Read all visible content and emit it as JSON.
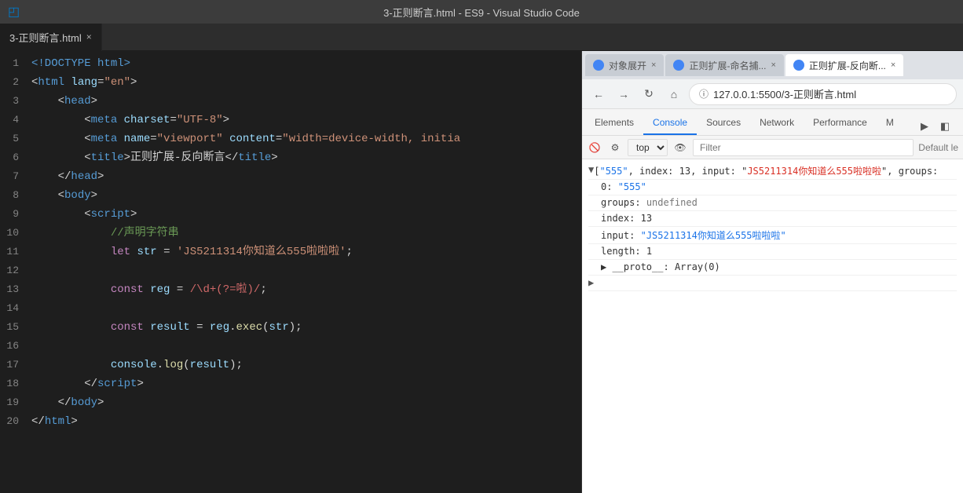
{
  "titleBar": {
    "title": "3-正则断言.html - ES9 - Visual Studio Code",
    "icon": "⬡"
  },
  "editorTab": {
    "label": "3-正则断言.html",
    "close": "×"
  },
  "codeLines": [
    {
      "num": 1,
      "tokens": [
        {
          "t": "<!DOCTYPE ",
          "c": "kw"
        },
        {
          "t": "html",
          "c": "kw"
        },
        {
          "t": ">",
          "c": "kw"
        }
      ]
    },
    {
      "num": 2,
      "tokens": [
        {
          "t": "<",
          "c": "punct"
        },
        {
          "t": "html",
          "c": "kw"
        },
        {
          "t": " ",
          "c": ""
        },
        {
          "t": "lang",
          "c": "attr"
        },
        {
          "t": "=",
          "c": "punct"
        },
        {
          "t": "\"en\"",
          "c": "str"
        },
        {
          "t": ">",
          "c": "punct"
        }
      ]
    },
    {
      "num": 3,
      "tokens": [
        {
          "t": "    <",
          "c": "punct"
        },
        {
          "t": "head",
          "c": "kw"
        },
        {
          "t": ">",
          "c": "punct"
        }
      ]
    },
    {
      "num": 4,
      "tokens": [
        {
          "t": "        <",
          "c": "punct"
        },
        {
          "t": "meta",
          "c": "kw"
        },
        {
          "t": " ",
          "c": ""
        },
        {
          "t": "charset",
          "c": "attr"
        },
        {
          "t": "=",
          "c": "punct"
        },
        {
          "t": "\"UTF-8\"",
          "c": "str"
        },
        {
          "t": ">",
          "c": "punct"
        }
      ]
    },
    {
      "num": 5,
      "tokens": [
        {
          "t": "        <",
          "c": "punct"
        },
        {
          "t": "meta",
          "c": "kw"
        },
        {
          "t": " ",
          "c": ""
        },
        {
          "t": "name",
          "c": "attr"
        },
        {
          "t": "=",
          "c": "punct"
        },
        {
          "t": "\"viewport\"",
          "c": "str"
        },
        {
          "t": " ",
          "c": ""
        },
        {
          "t": "content",
          "c": "attr"
        },
        {
          "t": "=",
          "c": "punct"
        },
        {
          "t": "\"width=device-width, initia",
          "c": "str"
        }
      ]
    },
    {
      "num": 6,
      "tokens": [
        {
          "t": "        <",
          "c": "punct"
        },
        {
          "t": "title",
          "c": "kw"
        },
        {
          "t": ">",
          "c": "punct"
        },
        {
          "t": "正则扩展-反向断言",
          "c": "white"
        },
        {
          "t": "</",
          "c": "punct"
        },
        {
          "t": "title",
          "c": "kw"
        },
        {
          "t": ">",
          "c": "punct"
        }
      ]
    },
    {
      "num": 7,
      "tokens": [
        {
          "t": "    </",
          "c": "punct"
        },
        {
          "t": "head",
          "c": "kw"
        },
        {
          "t": ">",
          "c": "punct"
        }
      ]
    },
    {
      "num": 8,
      "tokens": [
        {
          "t": "    <",
          "c": "punct"
        },
        {
          "t": "body",
          "c": "kw"
        },
        {
          "t": ">",
          "c": "punct"
        }
      ]
    },
    {
      "num": 9,
      "tokens": [
        {
          "t": "        <",
          "c": "punct"
        },
        {
          "t": "script",
          "c": "kw"
        },
        {
          "t": ">",
          "c": "punct"
        }
      ]
    },
    {
      "num": 10,
      "tokens": [
        {
          "t": "            ",
          "c": ""
        },
        {
          "t": "//声明字符串",
          "c": "green"
        }
      ]
    },
    {
      "num": 11,
      "tokens": [
        {
          "t": "            ",
          "c": ""
        },
        {
          "t": "let",
          "c": "pink"
        },
        {
          "t": " ",
          "c": ""
        },
        {
          "t": "str",
          "c": "prop"
        },
        {
          "t": " = ",
          "c": "white"
        },
        {
          "t": "'JS5211314你知道么555啦啦啦'",
          "c": "str"
        },
        {
          "t": ";",
          "c": "white"
        }
      ]
    },
    {
      "num": 12,
      "tokens": []
    },
    {
      "num": 13,
      "tokens": [
        {
          "t": "            ",
          "c": ""
        },
        {
          "t": "const",
          "c": "pink"
        },
        {
          "t": " ",
          "c": ""
        },
        {
          "t": "reg",
          "c": "prop"
        },
        {
          "t": " = ",
          "c": "white"
        },
        {
          "t": "/\\d+(?=啦)/",
          "c": "regex"
        },
        {
          "t": ";",
          "c": "white"
        }
      ]
    },
    {
      "num": 14,
      "tokens": []
    },
    {
      "num": 15,
      "tokens": [
        {
          "t": "            ",
          "c": ""
        },
        {
          "t": "const",
          "c": "pink"
        },
        {
          "t": " ",
          "c": ""
        },
        {
          "t": "result",
          "c": "prop"
        },
        {
          "t": " = ",
          "c": "white"
        },
        {
          "t": "reg",
          "c": "prop"
        },
        {
          "t": ".",
          "c": "white"
        },
        {
          "t": "exec",
          "c": "yellow"
        },
        {
          "t": "(",
          "c": "white"
        },
        {
          "t": "str",
          "c": "prop"
        },
        {
          "t": ");",
          "c": "white"
        }
      ]
    },
    {
      "num": 16,
      "tokens": []
    },
    {
      "num": 17,
      "tokens": [
        {
          "t": "            ",
          "c": ""
        },
        {
          "t": "console",
          "c": "prop"
        },
        {
          "t": ".",
          "c": "white"
        },
        {
          "t": "log",
          "c": "yellow"
        },
        {
          "t": "(",
          "c": "white"
        },
        {
          "t": "result",
          "c": "prop"
        },
        {
          "t": ");",
          "c": "white"
        }
      ]
    },
    {
      "num": 18,
      "tokens": [
        {
          "t": "        </",
          "c": "punct"
        },
        {
          "t": "script",
          "c": "kw"
        },
        {
          "t": ">",
          "c": "punct"
        }
      ]
    },
    {
      "num": 19,
      "tokens": [
        {
          "t": "    </",
          "c": "punct"
        },
        {
          "t": "body",
          "c": "kw"
        },
        {
          "t": ">",
          "c": "punct"
        }
      ]
    },
    {
      "num": 20,
      "tokens": [
        {
          "t": "</",
          "c": "punct"
        },
        {
          "t": "html",
          "c": "kw"
        },
        {
          "t": ">",
          "c": "punct"
        }
      ]
    }
  ],
  "browserTabs": [
    {
      "label": "对象展开",
      "active": false,
      "favicon": true
    },
    {
      "label": "正则扩展-命名捕...",
      "active": false,
      "favicon": true
    },
    {
      "label": "正则扩展-反向断...",
      "active": true,
      "favicon": true
    }
  ],
  "addressBar": {
    "url": "127.0.0.1:5500/3-正则断言.html"
  },
  "devtoolsTabs": [
    {
      "label": "Elements",
      "active": false
    },
    {
      "label": "Console",
      "active": true
    },
    {
      "label": "Sources",
      "active": false
    },
    {
      "label": "Network",
      "active": false
    },
    {
      "label": "Performance",
      "active": false
    },
    {
      "label": "M",
      "active": false
    }
  ],
  "consoleToolbar": {
    "contextValue": "top",
    "filterPlaceholder": "Filter",
    "defaultLabel": "Default le"
  },
  "consoleOutput": {
    "expandSymbol": "▼",
    "collapseSymbol": "▶",
    "line1": {
      "prefix": "▼ [\"555\", index: 13, input: \"",
      "inputStr": "JS5211314你知道么555啦啦啦",
      "suffix": "\", groups:"
    },
    "items": [
      {
        "indent": 1,
        "key": "0:",
        "value": "\"555\"",
        "valueClass": "c-blue"
      },
      {
        "indent": 1,
        "key": "groups:",
        "value": "undefined",
        "valueClass": "c-gray"
      },
      {
        "indent": 1,
        "key": "index:",
        "value": "13",
        "valueClass": "c-dark"
      },
      {
        "indent": 1,
        "key": "input:",
        "value": "\"JS5211314你知道么555啦啦啦\"",
        "valueClass": "c-blue"
      },
      {
        "indent": 1,
        "key": "length:",
        "value": "1",
        "valueClass": "c-dark"
      },
      {
        "indent": 1,
        "key": "▶ __proto__:",
        "value": "Array(0)",
        "valueClass": "c-dark"
      }
    ],
    "lastLine": "▶"
  }
}
